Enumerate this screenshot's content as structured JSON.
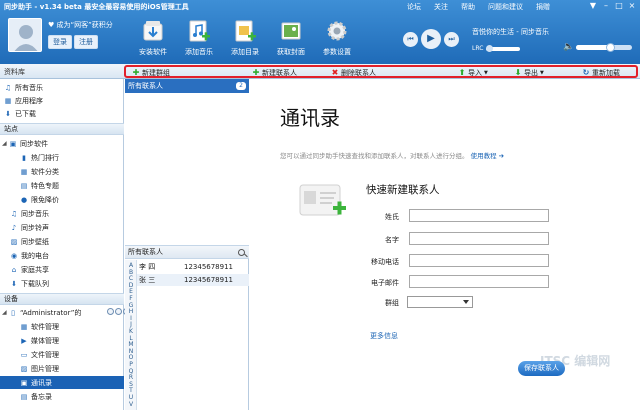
{
  "header": {
    "title": "同步助手 - v1.34 beta  最安全最容易使用的iOS管理工具",
    "top_menu": [
      "论坛",
      "关注",
      "帮助",
      "问题和建议",
      "捐赠"
    ],
    "user_line": "成为“网客”获积分",
    "login_label": "登录",
    "register_label": "注册",
    "toolbar": [
      {
        "label": "安装软件",
        "icon": "install-app-icon"
      },
      {
        "label": "添加音乐",
        "icon": "add-music-icon"
      },
      {
        "label": "添加目录",
        "icon": "add-folder-icon"
      },
      {
        "label": "获取封面",
        "icon": "get-cover-icon"
      },
      {
        "label": "参数设置",
        "icon": "settings-gear-icon"
      }
    ],
    "now_playing": "音悦你的生活 - 同步音乐",
    "lrc_label": "LRC",
    "volume": 0.6,
    "accent": "#2a6fc0"
  },
  "actionbar": {
    "library_label": "资料库",
    "new_group": "新建群组",
    "new_contact": "新建联系人",
    "delete_contact": "删除联系人",
    "import": "导入",
    "export": "导出",
    "reload": "重新加载"
  },
  "sidebar": {
    "library_items": [
      "所有音乐",
      "应用程序",
      "已下载"
    ],
    "station_header": "站点",
    "station_items": [
      {
        "label": "同步软件",
        "indent": 0,
        "expand": true
      },
      {
        "label": "热门排行",
        "indent": 1
      },
      {
        "label": "软件分类",
        "indent": 1
      },
      {
        "label": "特色专题",
        "indent": 1
      },
      {
        "label": "限免降价",
        "indent": 1
      },
      {
        "label": "同步音乐",
        "indent": 0
      },
      {
        "label": "同步铃声",
        "indent": 0
      },
      {
        "label": "同步壁纸",
        "indent": 0
      },
      {
        "label": "我的电台",
        "indent": 0
      },
      {
        "label": "家庭共享",
        "indent": 0
      },
      {
        "label": "下载队列",
        "indent": 0
      }
    ],
    "device_header": "设备",
    "device_name": "“Administrator”的",
    "device_items": [
      "软件管理",
      "媒体管理",
      "文件管理",
      "图片管理",
      "通讯录",
      "备忘录"
    ],
    "selected_device_item": "通讯录"
  },
  "contacts": {
    "all_label": "所有联系人",
    "all_count": "2",
    "list_header": "所有联系人",
    "alphabet": [
      "A",
      "B",
      "C",
      "D",
      "E",
      "F",
      "G",
      "H",
      "I",
      "J",
      "K",
      "L",
      "M",
      "N",
      "O",
      "P",
      "Q",
      "R",
      "S",
      "T",
      "U",
      "V"
    ],
    "rows": [
      {
        "name": "李 四",
        "phone": "12345678911"
      },
      {
        "name": "张 三",
        "phone": "12345678911"
      }
    ]
  },
  "main": {
    "title": "通讯录",
    "desc_prefix": "您可以通过同步助手快速查找和添加联系人，对联系人进行分组。",
    "tutorial_link": "使用教程",
    "quick_title": "快速新建联系人",
    "fields": [
      "姓氏",
      "名字",
      "移动电话",
      "电子邮件"
    ],
    "group_label": "群组",
    "more_info": "更多信息",
    "save_label": "保存联系人",
    "watermark": "ITSC 编辑网"
  }
}
